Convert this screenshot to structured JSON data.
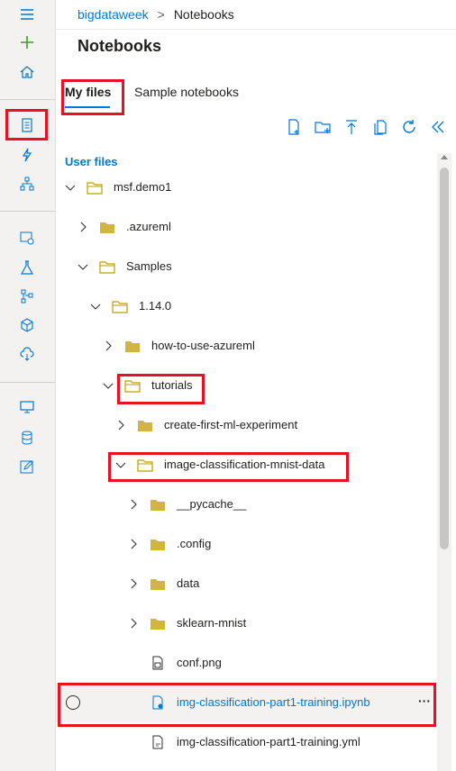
{
  "breadcrumb": {
    "workspace": "bigdataweek",
    "separator": ">",
    "current": "Notebooks"
  },
  "title": "Notebooks",
  "tabs": {
    "my_files": "My files",
    "sample": "Sample notebooks"
  },
  "section_label": "User files",
  "tree": [
    {
      "label": "msf.demo1"
    },
    {
      "label": ".azureml"
    },
    {
      "label": "Samples"
    },
    {
      "label": "1.14.0"
    },
    {
      "label": "how-to-use-azureml"
    },
    {
      "label": "tutorials"
    },
    {
      "label": "create-first-ml-experiment"
    },
    {
      "label": "image-classification-mnist-data"
    },
    {
      "label": "__pycache__"
    },
    {
      "label": ".config"
    },
    {
      "label": "data"
    },
    {
      "label": "sklearn-mnist"
    },
    {
      "label": "conf.png"
    },
    {
      "label": "img-classification-part1-training.ipynb",
      "more": "···"
    },
    {
      "label": "img-classification-part1-training.yml"
    }
  ],
  "colors": {
    "accent": "#0078d4",
    "folder": "#c19c00",
    "highlight": "#e81123",
    "selected_bg": "#f3f2f1"
  }
}
